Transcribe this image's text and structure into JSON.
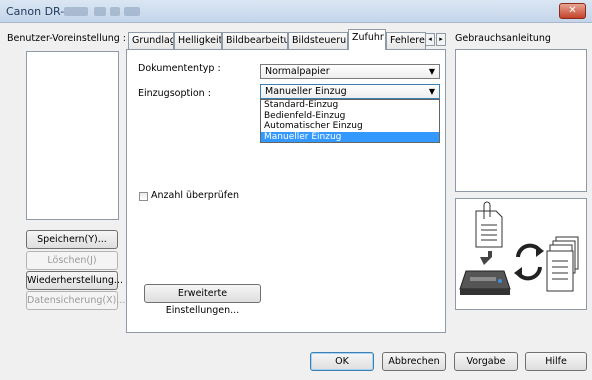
{
  "window": {
    "title": "Canon DR-",
    "close_glyph": "✕"
  },
  "left": {
    "label": "Benutzer-Voreinstellung :",
    "buttons": {
      "save": "Speichern(Y)...",
      "delete": "Löschen(J)",
      "restore": "Wiederherstellung...",
      "backup": "Datensicherung(X)..."
    }
  },
  "tabs": [
    "Grundlage",
    "Helligkeit",
    "Bildbearbeitung",
    "Bildsteuerung",
    "Zufuhr",
    "Fehlererk"
  ],
  "tab_scroll": {
    "left": "◂",
    "right": "▸"
  },
  "feed": {
    "doc_type_label": "Dokumententyp :",
    "doc_type_value": "Normalpapier",
    "feed_option_label": "Einzugsoption :",
    "feed_option_value": "Manueller Einzug",
    "feed_options": [
      "Standard-Einzug",
      "Bedienfeld-Einzug",
      "Automatischer Einzug",
      "Manueller Einzug"
    ],
    "selected_option_index": 3,
    "check_count_label": "Anzahl überprüfen",
    "check_count_checked": false,
    "advanced_button": "Erweiterte Einstellungen..."
  },
  "help": {
    "label": "Gebrauchsanleitung"
  },
  "bottom": {
    "ok": "OK",
    "cancel": "Abbrechen",
    "default": "Vorgabe",
    "help": "Hilfe"
  },
  "icons": {
    "dropdown_arrow": "▼"
  }
}
